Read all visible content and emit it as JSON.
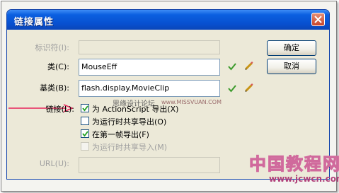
{
  "dialog": {
    "title": "链接属性",
    "colors": {
      "titlebar": "#0a5fe0",
      "accent_arrow": "#e8245a",
      "check_icon": "#3a9a2a"
    }
  },
  "form": {
    "identifier_label": "标识符(I):",
    "identifier_value": "",
    "class_label": "类(C):",
    "class_value": "MouseEff",
    "base_class_label": "基类(B):",
    "base_class_value": "flash.display.MovieClip",
    "linkage_label": "链接(L):",
    "url_label": "URL(U):",
    "url_value": ""
  },
  "buttons": {
    "ok": "确定",
    "cancel": "取消"
  },
  "linkage_options": [
    {
      "label": "为 ActionScript 导出(X)",
      "checked": true,
      "enabled": true
    },
    {
      "label": "为运行时共享导出(O)",
      "checked": false,
      "enabled": true
    },
    {
      "label": "在第一帧导出(F)",
      "checked": true,
      "enabled": true
    },
    {
      "label": "为运行时共享导入(M)",
      "checked": false,
      "enabled": false
    }
  ],
  "watermarks": {
    "center_text": "思缘设计论坛",
    "center_url": "www.MISSVUAN.COM",
    "brand_cn": "中国教程网",
    "brand_url": "www.jcwcn.com"
  },
  "icons": {
    "validate": "check-icon",
    "edit": "pencil-icon",
    "close": "close-icon"
  }
}
